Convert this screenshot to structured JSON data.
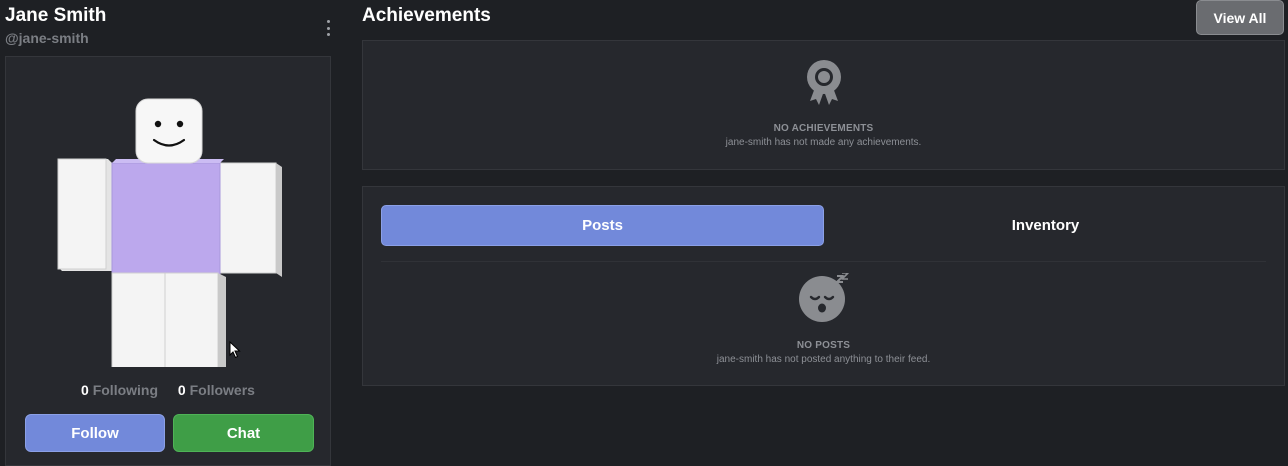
{
  "profile": {
    "display_name": "Jane Smith",
    "username": "@jane-smith",
    "following_count": "0",
    "following_label": "Following",
    "followers_count": "0",
    "followers_label": "Followers",
    "follow_label": "Follow",
    "chat_label": "Chat",
    "shirt_color": "#bca8ed"
  },
  "achievements": {
    "title": "Achievements",
    "view_all_label": "View All",
    "empty_title": "NO ACHIEVEMENTS",
    "empty_sub": "jane-smith has not made any achievements.",
    "icon": "award-badge-icon"
  },
  "feed": {
    "tabs": [
      {
        "label": "Posts",
        "active": true
      },
      {
        "label": "Inventory",
        "active": false
      }
    ],
    "empty_title": "NO POSTS",
    "empty_sub": "jane-smith has not posted anything to their feed.",
    "icon": "sleeping-face-icon"
  },
  "colors": {
    "accent": "#7289da",
    "success": "#3f9e47",
    "background": "#1e2024",
    "panel": "#26282d"
  }
}
